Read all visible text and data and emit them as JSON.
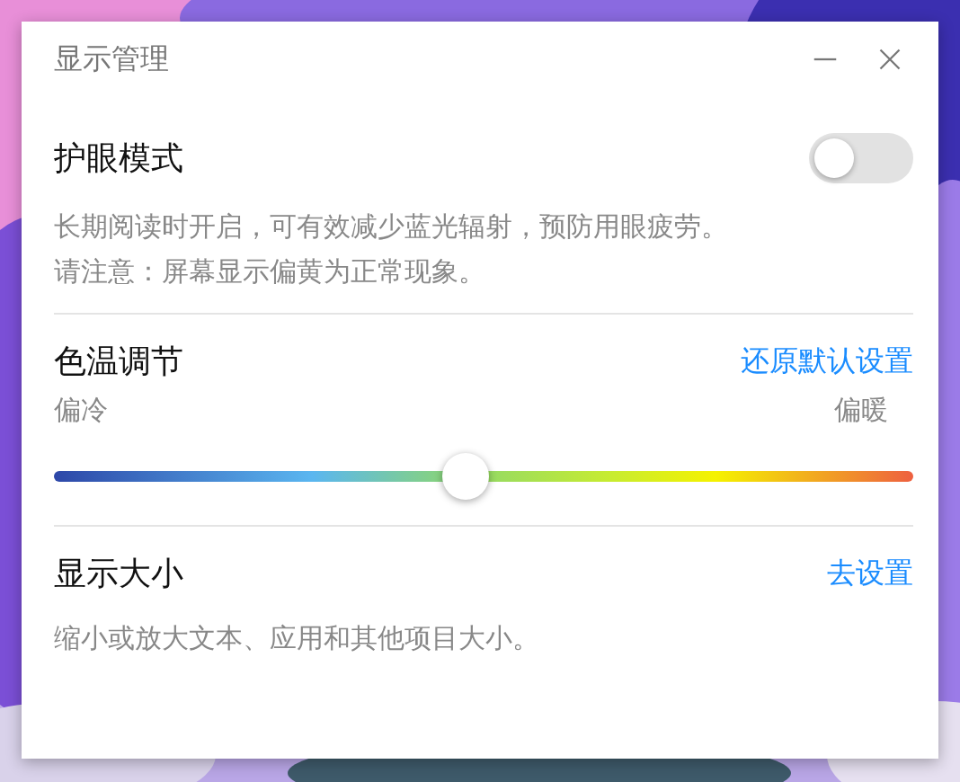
{
  "window": {
    "title": "显示管理"
  },
  "eye_mode": {
    "title": "护眼模式",
    "on": false,
    "description": [
      "长期阅读时开启，可有效减少蓝光辐射，预防用眼疲劳。",
      "请注意：屏幕显示偏黄为正常现象。"
    ]
  },
  "color_temperature": {
    "title": "色温调节",
    "reset_link": "还原默认设置",
    "min_label": "偏冷",
    "max_label": "偏暖",
    "level": 0.48
  },
  "display_size": {
    "title": "显示大小",
    "link": "去设置",
    "description": "缩小或放大文本、应用和其他项目大小。"
  }
}
